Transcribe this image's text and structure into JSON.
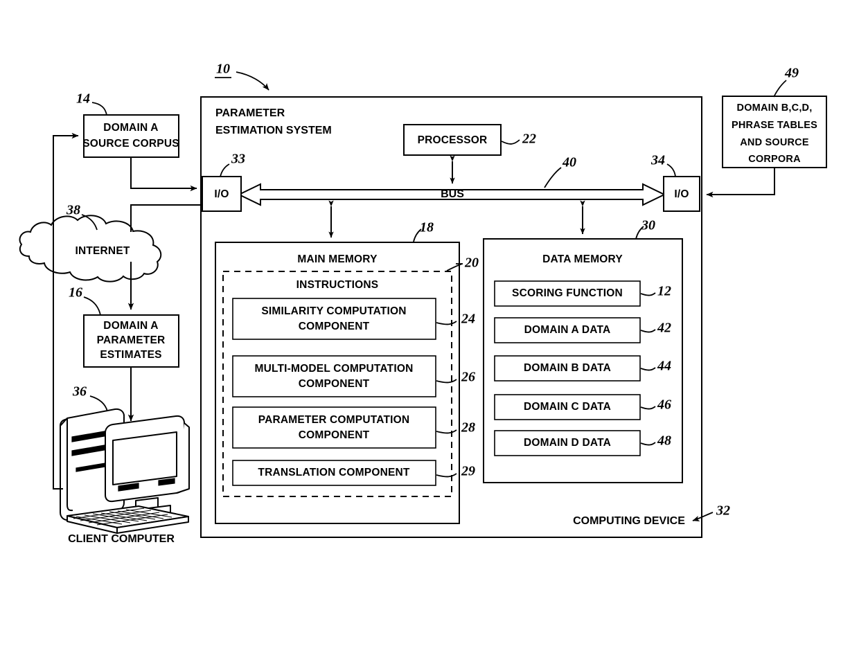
{
  "figure": {
    "system_title_line1": "PARAMETER",
    "system_title_line2": "ESTIMATION SYSTEM",
    "system_ref": "10",
    "bus_label": "BUS",
    "bus_ref": "40",
    "computing_device_label": "COMPUTING DEVICE",
    "computing_device_ref": "32"
  },
  "external": {
    "source_corpus": {
      "line1": "DOMAIN A",
      "line2": "SOURCE CORPUS",
      "ref": "14"
    },
    "internet": {
      "label": "INTERNET",
      "ref": "38"
    },
    "parameter_estimates": {
      "line1": "DOMAIN A",
      "line2": "PARAMETER",
      "line3": "ESTIMATES",
      "ref": "16"
    },
    "client_computer": {
      "caption": "CLIENT COMPUTER",
      "ref": "36"
    },
    "phrase_tables": {
      "line1": "DOMAIN B,C,D,",
      "line2": "PHRASE TABLES",
      "line3": "AND SOURCE",
      "line4": "CORPORA",
      "ref": "49"
    }
  },
  "internal": {
    "processor": {
      "label": "PROCESSOR",
      "ref": "22"
    },
    "io_left": {
      "label": "I/O",
      "ref": "33"
    },
    "io_right": {
      "label": "I/O",
      "ref": "34"
    },
    "main_memory": {
      "label": "MAIN MEMORY",
      "ref": "18",
      "instructions_label": "INSTRUCTIONS",
      "instructions_ref": "20",
      "components": [
        {
          "line1": "SIMILARITY COMPUTATION",
          "line2": "COMPONENT",
          "ref": "24"
        },
        {
          "line1": "MULTI-MODEL COMPUTATION",
          "line2": "COMPONENT",
          "ref": "26"
        },
        {
          "line1": "PARAMETER COMPUTATION",
          "line2": "COMPONENT",
          "ref": "28"
        },
        {
          "line1": "TRANSLATION COMPONENT",
          "line2": "",
          "ref": "29"
        }
      ]
    },
    "data_memory": {
      "label": "DATA MEMORY",
      "ref": "30",
      "items": [
        {
          "label": "SCORING FUNCTION",
          "ref": "12"
        },
        {
          "label": "DOMAIN A DATA",
          "ref": "42"
        },
        {
          "label": "DOMAIN B DATA",
          "ref": "44"
        },
        {
          "label": "DOMAIN C DATA",
          "ref": "46"
        },
        {
          "label": "DOMAIN D DATA",
          "ref": "48"
        }
      ]
    }
  }
}
